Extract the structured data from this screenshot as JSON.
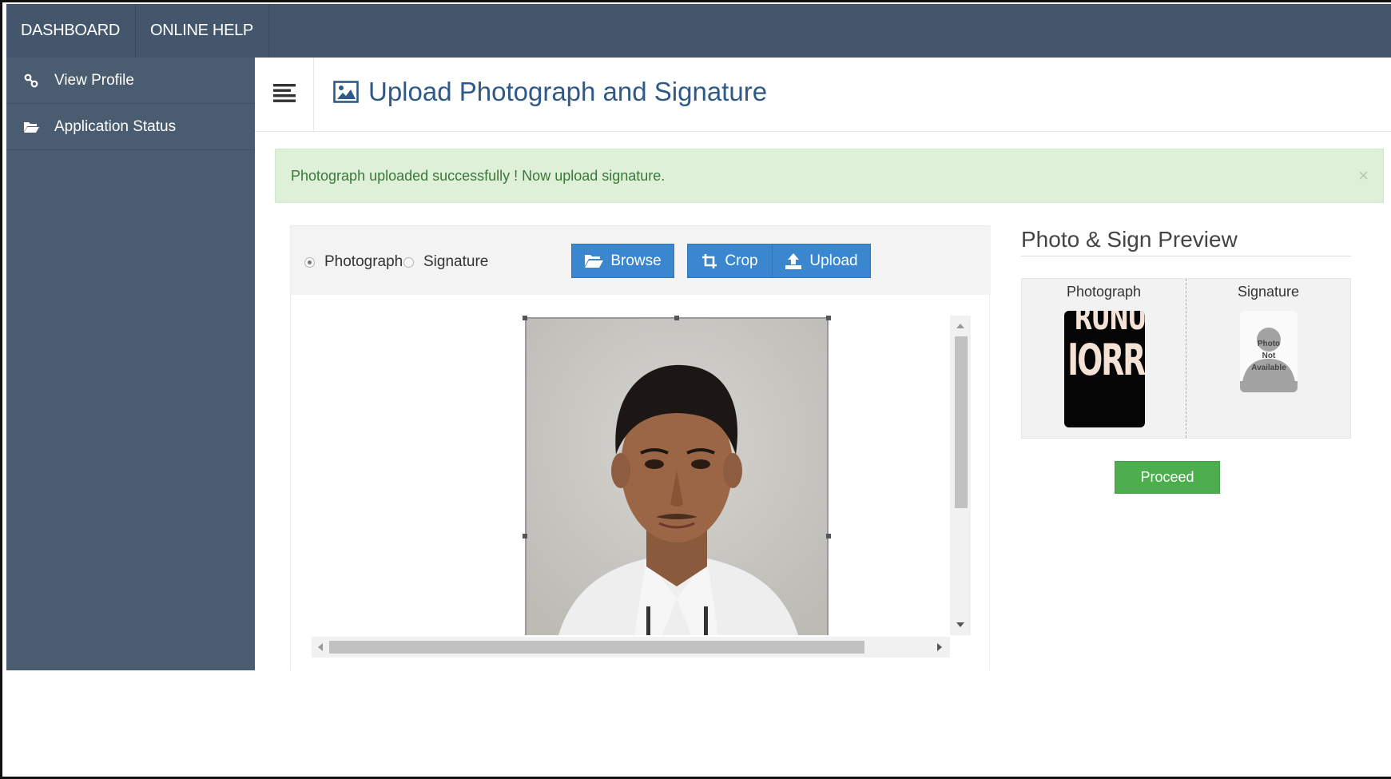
{
  "topnav": {
    "dashboard": "DASHBOARD",
    "online_help": "ONLINE HELP"
  },
  "sidebar": {
    "items": [
      {
        "label": "View Profile",
        "icon": "link-icon"
      },
      {
        "label": "Application Status",
        "icon": "folder-open-icon"
      }
    ]
  },
  "header": {
    "title": "Upload Photograph and Signature",
    "icon": "image-icon"
  },
  "alert": {
    "message": "Photograph uploaded successfully ! Now upload signature.",
    "close": "×"
  },
  "uploader": {
    "radio_photograph": "Photograph",
    "radio_signature": "Signature",
    "selected": "Photograph",
    "browse_label": "Browse",
    "crop_label": "Crop",
    "upload_label": "Upload"
  },
  "preview": {
    "title": "Photo & Sign Preview",
    "photo_label": "Photograph",
    "sign_label": "Signature",
    "photo_thumb_text_1": "RUNU",
    "photo_thumb_text_2": "IORRO",
    "sign_placeholder_1": "Photo",
    "sign_placeholder_2": "Not",
    "sign_placeholder_3": "Available"
  },
  "actions": {
    "proceed_label": "Proceed"
  },
  "colors": {
    "nav_bg": "#44566b",
    "sidebar_bg": "#4a5c6f",
    "primary": "#3a87d0",
    "success": "#4cae4c",
    "alert_bg": "#dff0d8",
    "title": "#2f5a88"
  }
}
